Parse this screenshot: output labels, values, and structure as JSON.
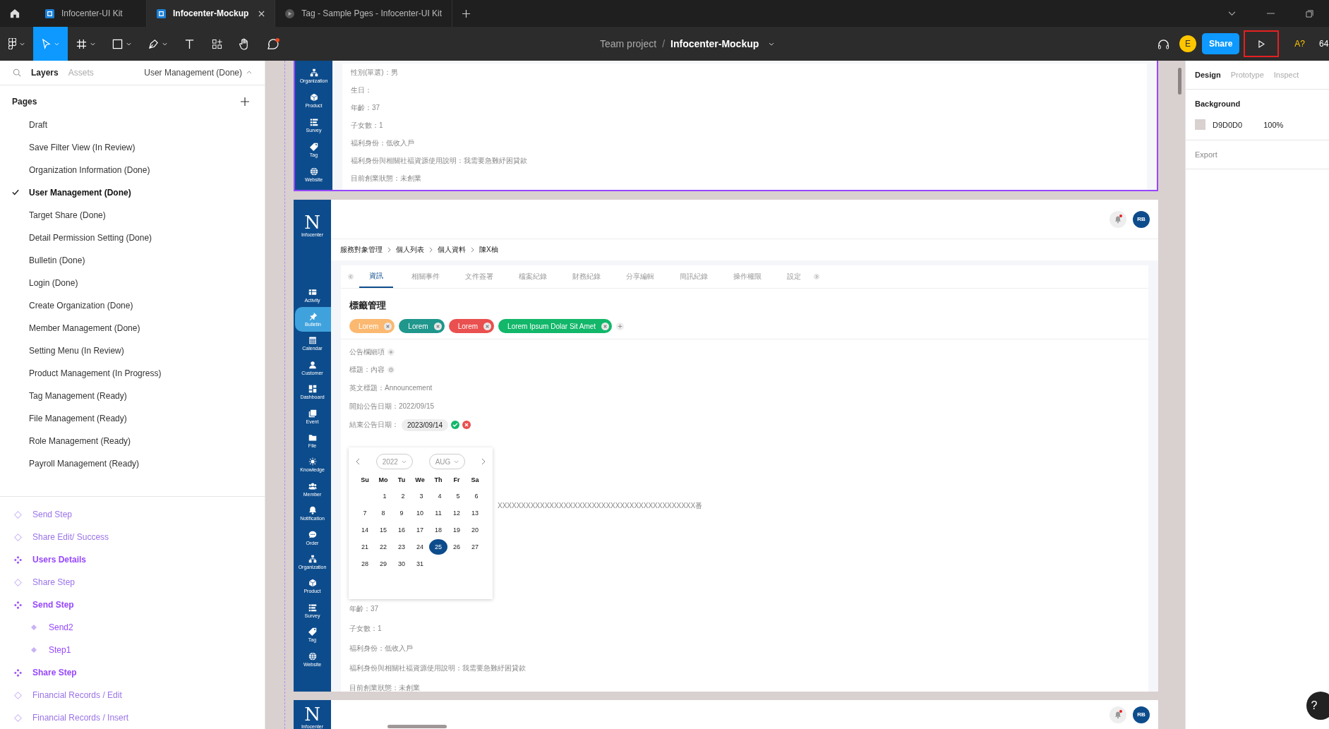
{
  "browser_tabs": [
    {
      "label": "Infocenter-UI Kit",
      "selected": false,
      "kind": "file"
    },
    {
      "label": "Infocenter-Mockup",
      "selected": true,
      "kind": "file"
    },
    {
      "label": "Tag - Sample Pges - Infocenter-UI Kit",
      "selected": false,
      "kind": "prototype"
    }
  ],
  "toolbar": {
    "team": "Team project",
    "separator": "/",
    "file": "Infocenter-Mockup",
    "avatar": "E",
    "share": "Share",
    "missing_fonts": "A?",
    "zoom": "64"
  },
  "left_panel": {
    "tabs": [
      {
        "label": "Layers",
        "selected": true
      },
      {
        "label": "Assets",
        "selected": false
      }
    ],
    "current_page": "User Management (Done)",
    "pages_title": "Pages",
    "pages": [
      {
        "label": "Draft",
        "selected": false
      },
      {
        "label": "Save Filter View (In Review)",
        "selected": false
      },
      {
        "label": "Organization Information (Done)",
        "selected": false
      },
      {
        "label": "User Management (Done)",
        "selected": true
      },
      {
        "label": "Target Share (Done)",
        "selected": false
      },
      {
        "label": "Detail Permission Setting (Done)",
        "selected": false
      },
      {
        "label": "Bulletin (Done)",
        "selected": false
      },
      {
        "label": "Login (Done)",
        "selected": false
      },
      {
        "label": "Create Organization (Done)",
        "selected": false
      },
      {
        "label": "Member Management (Done)",
        "selected": false
      },
      {
        "label": "Setting Menu (In Review)",
        "selected": false
      },
      {
        "label": "Product Management (In Progress)",
        "selected": false
      },
      {
        "label": "Tag Management (Ready)",
        "selected": false
      },
      {
        "label": "File Management (Ready)",
        "selected": false
      },
      {
        "label": "Role Management (Ready)",
        "selected": false
      },
      {
        "label": "Payroll Management (Ready)",
        "selected": false
      }
    ],
    "layers": [
      {
        "label": "Send Step",
        "kind": "instance"
      },
      {
        "label": "Share Edit/ Success",
        "kind": "instance"
      },
      {
        "label": "Users Details",
        "kind": "component"
      },
      {
        "label": "Share Step",
        "kind": "instance"
      },
      {
        "label": "Send Step",
        "kind": "component",
        "children": [
          {
            "label": "Send2",
            "kind": "variant"
          },
          {
            "label": "Step1",
            "kind": "variant"
          }
        ]
      },
      {
        "label": "Share Step",
        "kind": "component"
      },
      {
        "label": "Financial Records / Edit",
        "kind": "instance"
      },
      {
        "label": "Financial Records / Insert",
        "kind": "instance"
      }
    ]
  },
  "canvas": {
    "frame_top": {
      "selected": true,
      "nav": [
        {
          "label": "Organization",
          "selected": false
        },
        {
          "label": "Product",
          "selected": false
        },
        {
          "label": "Survey",
          "selected": false
        },
        {
          "label": "Tag",
          "selected": false
        },
        {
          "label": "Website",
          "selected": false
        }
      ],
      "details": [
        "性別(單選)：男",
        "生日：",
        "年齡：37",
        "子女數：1",
        "福利身份：低收入戶",
        "福利身份與相關社福資源使用說明：我需要急難紓困貸款",
        "目前創業狀態：未創業"
      ]
    },
    "frame_main": {
      "brand": {
        "mark": "N",
        "name": "Infocenter"
      },
      "nav": [
        {
          "label": "Activity",
          "selected": false
        },
        {
          "label": "Bulletin",
          "selected": true
        },
        {
          "label": "Calendar",
          "selected": false
        },
        {
          "label": "Customer",
          "selected": false
        },
        {
          "label": "Dashboard",
          "selected": false
        },
        {
          "label": "Event",
          "selected": false
        },
        {
          "label": "File",
          "selected": false
        },
        {
          "label": "Knowledge",
          "selected": false
        },
        {
          "label": "Member",
          "selected": false
        },
        {
          "label": "Notification",
          "selected": false
        },
        {
          "label": "Order",
          "selected": false
        },
        {
          "label": "Organization",
          "selected": false
        },
        {
          "label": "Product",
          "selected": false
        },
        {
          "label": "Survey",
          "selected": false
        },
        {
          "label": "Tag",
          "selected": false
        },
        {
          "label": "Website",
          "selected": false
        }
      ],
      "unread": true,
      "avatar": "RB",
      "breadcrumb": [
        "服務對象管理",
        "個人列表",
        "個人資料",
        "陳X柚"
      ],
      "tabs": [
        {
          "label": "資訊",
          "selected": true
        },
        {
          "label": "相關事件",
          "selected": false
        },
        {
          "label": "文件簽署",
          "selected": false
        },
        {
          "label": "檔案紀錄",
          "selected": false
        },
        {
          "label": "財務紀錄",
          "selected": false
        },
        {
          "label": "分享編輯",
          "selected": false
        },
        {
          "label": "簡訊紀錄",
          "selected": false
        },
        {
          "label": "操作權限",
          "selected": false
        },
        {
          "label": "設定",
          "selected": false
        }
      ],
      "section_title": "標籤管理",
      "tags": [
        {
          "label": "Lorem",
          "color": "#fbb870"
        },
        {
          "label": "Lorem",
          "color": "#1f978c"
        },
        {
          "label": "Lorem",
          "color": "#e9504f"
        },
        {
          "label": "Lorem Ipsum Dolar Sit Amet",
          "color": "#12b76a"
        }
      ],
      "fields": [
        {
          "kind": "add",
          "label": "公告欄細項"
        },
        {
          "kind": "history",
          "label": "標題：內容"
        },
        {
          "kind": "text",
          "label": "英文標題：Announcement"
        },
        {
          "kind": "text",
          "label": "開始公告日期：2022/09/15"
        }
      ],
      "date_field": {
        "label": "結束公告日期：",
        "value": "2023/09/14"
      },
      "calendar": {
        "year": "2022",
        "month": "AUG",
        "weekdays": [
          "Su",
          "Mo",
          "Tu",
          "We",
          "Th",
          "Fr",
          "Sa"
        ],
        "weeks": [
          [
            {
              "label": "1",
              "selected": false
            },
            {
              "label": "2",
              "selected": false
            },
            {
              "label": "3",
              "selected": false
            },
            {
              "label": "4",
              "selected": false
            },
            {
              "label": "5",
              "selected": false
            },
            {
              "label": "6",
              "selected": false
            }
          ],
          [
            {
              "label": "7",
              "selected": false
            },
            {
              "label": "8",
              "selected": false
            },
            {
              "label": "9",
              "selected": false
            },
            {
              "label": "10",
              "selected": false
            },
            {
              "label": "11",
              "selected": false
            },
            {
              "label": "12",
              "selected": false
            },
            {
              "label": "13",
              "selected": false
            }
          ],
          [
            {
              "label": "14",
              "selected": false
            },
            {
              "label": "15",
              "selected": false
            },
            {
              "label": "16",
              "selected": false
            },
            {
              "label": "17",
              "selected": false
            },
            {
              "label": "18",
              "selected": false
            },
            {
              "label": "19",
              "selected": false
            },
            {
              "label": "20",
              "selected": false
            }
          ],
          [
            {
              "label": "21",
              "selected": false
            },
            {
              "label": "22",
              "selected": false
            },
            {
              "label": "23",
              "selected": false
            },
            {
              "label": "24",
              "selected": false
            },
            {
              "label": "25",
              "selected": true
            },
            {
              "label": "26",
              "selected": false
            },
            {
              "label": "27",
              "selected": false
            }
          ],
          [
            {
              "label": "28",
              "selected": false
            },
            {
              "label": "29",
              "selected": false
            },
            {
              "label": "30",
              "selected": false
            },
            {
              "label": "31",
              "selected": false
            }
          ]
        ]
      },
      "notes": [
        {
          "kind": "covered",
          "text": "XXXXXXXXXXXXXXXXXXXXXXXXXXXXXXXXXXXXXXXXXX番"
        },
        {
          "kind": "text",
          "text": "年齡：37"
        },
        {
          "kind": "text",
          "text": "子女數：1"
        },
        {
          "kind": "text",
          "text": "福利身份：低收入戶"
        },
        {
          "kind": "text",
          "text": "福利身份與相關社福資源使用說明：我需要急難紓困貸款"
        },
        {
          "kind": "text",
          "text": "目前創業狀態：未創業"
        }
      ]
    },
    "frame_bottom": {
      "brand": {
        "mark": "N",
        "name": "Infocenter"
      },
      "unread": true,
      "avatar": "RB"
    }
  },
  "right_panel": {
    "tabs": [
      {
        "label": "Design",
        "selected": true
      },
      {
        "label": "Prototype",
        "selected": false
      },
      {
        "label": "Inspect",
        "selected": false
      }
    ],
    "background_title": "Background",
    "color": "#d9d0d0",
    "hex": "D9D0D0",
    "opacity": "100%",
    "export_title": "Export"
  },
  "help": "?"
}
